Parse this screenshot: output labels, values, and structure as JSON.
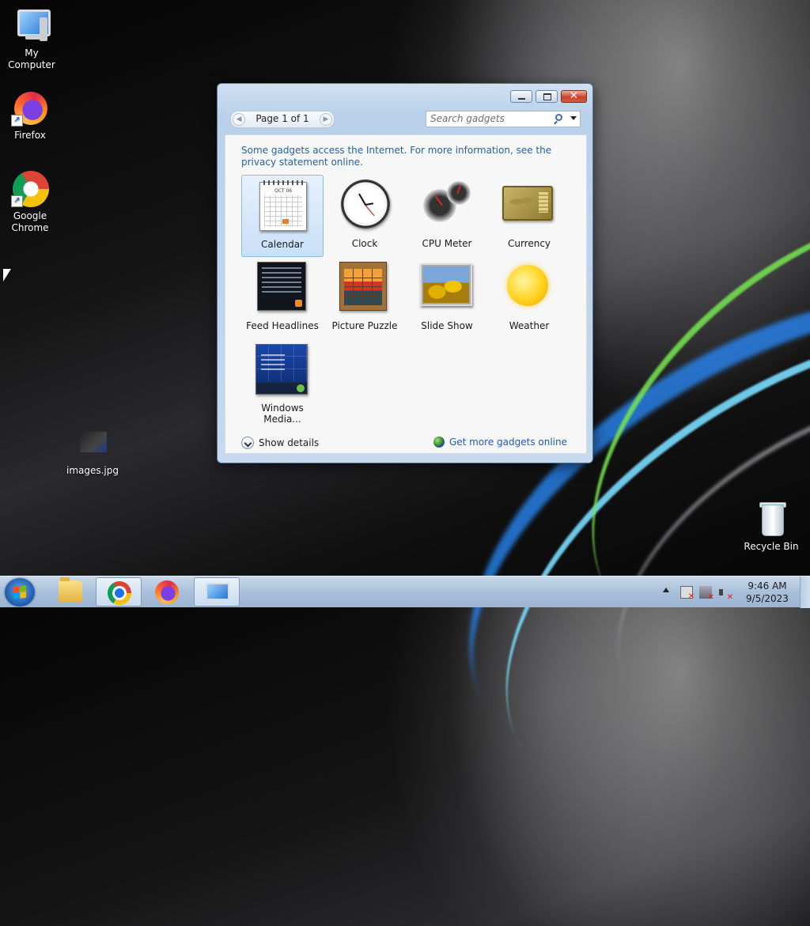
{
  "desktop": {
    "icons": [
      {
        "label": "My Computer",
        "icon": "computer-icon"
      },
      {
        "label": "Firefox",
        "icon": "firefox-icon"
      },
      {
        "label": "Google Chrome",
        "icon": "chrome-icon"
      },
      {
        "label": "images.jpg",
        "icon": "image-file-icon"
      },
      {
        "label": "Recycle Bin",
        "icon": "recycle-bin-icon"
      }
    ]
  },
  "gadget_window": {
    "pager": {
      "text": "Page 1 of 1"
    },
    "search": {
      "placeholder": "Search gadgets"
    },
    "notice": "Some gadgets access the Internet.  For more information, see the privacy statement online.",
    "gadgets": [
      {
        "label": "Calendar",
        "selected": true,
        "calendar_month": "OCT 06"
      },
      {
        "label": "Clock"
      },
      {
        "label": "CPU Meter"
      },
      {
        "label": "Currency"
      },
      {
        "label": "Feed Headlines"
      },
      {
        "label": "Picture Puzzle"
      },
      {
        "label": "Slide Show"
      },
      {
        "label": "Weather"
      },
      {
        "label": "Windows Media..."
      }
    ],
    "footer": {
      "details_label": "Show details",
      "online_label": "Get more gadgets online"
    }
  },
  "taskbar": {
    "buttons": [
      "start-button",
      "explorer",
      "chrome",
      "firefox",
      "gadgets"
    ],
    "clock": {
      "time": "9:46 AM",
      "date": "9/5/2023"
    }
  },
  "colors": {
    "link": "#2261a9",
    "selection": "#c9e0f8",
    "taskbar": "#a9c0da"
  }
}
